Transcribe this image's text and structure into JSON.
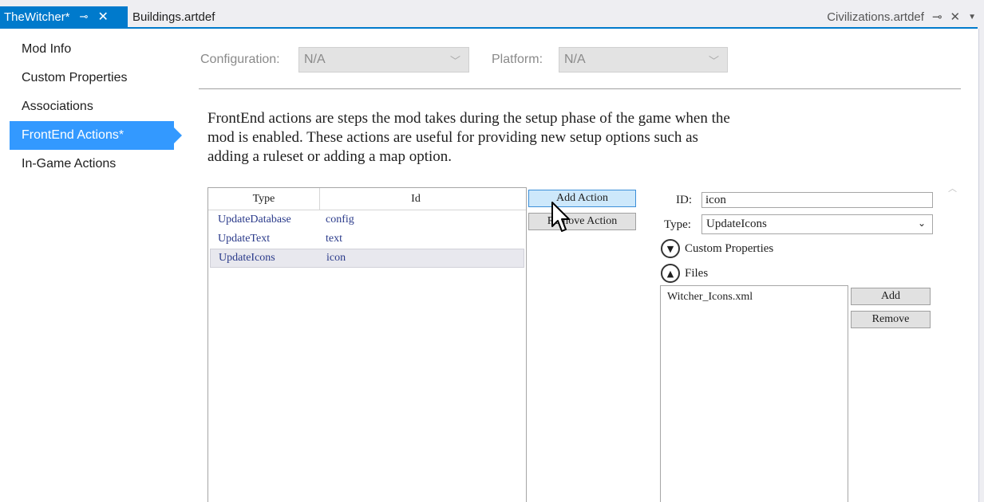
{
  "tabs": {
    "active": {
      "label": "TheWitcher*",
      "pin": "⊸",
      "close": "✕"
    },
    "inactive": {
      "label": "Buildings.artdef"
    },
    "right": {
      "label": "Civilizations.artdef",
      "pin": "⊸",
      "close": "✕",
      "dropdown": "▼"
    }
  },
  "sidebar": {
    "items": [
      {
        "label": "Mod Info"
      },
      {
        "label": "Custom Properties"
      },
      {
        "label": "Associations"
      },
      {
        "label": "FrontEnd Actions*"
      },
      {
        "label": "In-Game Actions"
      }
    ]
  },
  "config": {
    "configuration_label": "Configuration:",
    "configuration_value": "N/A",
    "platform_label": "Platform:",
    "platform_value": "N/A"
  },
  "description": "FrontEnd actions are steps the mod takes during the setup phase of the game when the\nmod is enabled.  These actions are useful for providing new setup options such as\nadding a ruleset or adding a map option.",
  "actions_table": {
    "columns": [
      "Type",
      "Id"
    ],
    "rows": [
      {
        "type": "UpdateDatabase",
        "id": "config"
      },
      {
        "type": "UpdateText",
        "id": "text"
      },
      {
        "type": "UpdateIcons",
        "id": "icon"
      }
    ]
  },
  "buttons": {
    "add_action": "Add Action",
    "remove_action": "Remove Action",
    "add": "Add",
    "remove": "Remove"
  },
  "details": {
    "id_label": "ID:",
    "id_value": "icon",
    "type_label": "Type:",
    "type_value": "UpdateIcons",
    "custom_properties_label": "Custom Properties",
    "files_label": "Files",
    "files": [
      "Witcher_Icons.xml"
    ]
  },
  "colors": {
    "accent": "#007acc",
    "selection": "#3399ff"
  }
}
